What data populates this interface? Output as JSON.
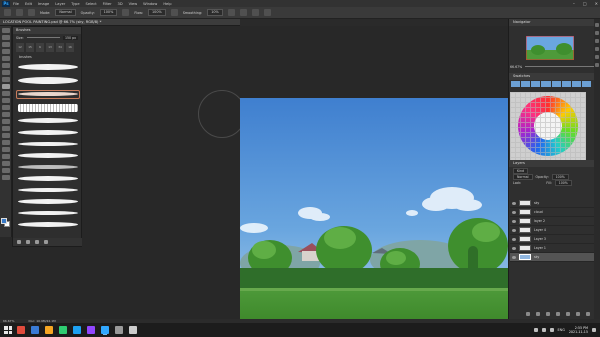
{
  "menubar": {
    "logo": "Ps",
    "items": [
      "File",
      "Edit",
      "Image",
      "Layer",
      "Type",
      "Select",
      "Filter",
      "3D",
      "View",
      "Window",
      "Help"
    ],
    "window_controls": [
      "–",
      "□",
      "✕"
    ]
  },
  "options_bar": {
    "mode_label": "Mode:",
    "mode_value": "Normal",
    "opacity_label": "Opacity:",
    "opacity_value": "100%",
    "flow_label": "Flow:",
    "flow_value": "100%",
    "smoothing_label": "Smoothing:",
    "smoothing_value": "10%"
  },
  "document": {
    "tab_title": "LOCATION POOL PAINTING.psd @ 66.7% (sky, RGB/8) *"
  },
  "brushes_panel": {
    "title": "Brushes",
    "size_label": "Size:",
    "size_value": "150 px",
    "presets": [
      "12",
      "15",
      "6",
      "13",
      "34",
      "16"
    ],
    "folder_label": "brushes"
  },
  "navigator": {
    "title": "Navigator",
    "zoom": "66.67%"
  },
  "color_panel": {
    "title": "Swatches",
    "accent": "#31a8ff"
  },
  "layers_panel": {
    "title": "Layers",
    "filter_label": "Kind",
    "blend_mode": "Normal",
    "opacity_label": "Opacity:",
    "opacity_value": "100%",
    "lock_label": "Lock:",
    "fill_label": "Fill:",
    "fill_value": "100%",
    "layers": [
      {
        "name": "sky",
        "thumb": "white",
        "active": false
      },
      {
        "name": "cloud",
        "thumb": "white",
        "active": false
      },
      {
        "name": "layer 2",
        "thumb": "white",
        "active": false
      },
      {
        "name": "Layer 4",
        "thumb": "white",
        "active": false
      },
      {
        "name": "Layer 3",
        "thumb": "white",
        "active": false
      },
      {
        "name": "Layer 1",
        "thumb": "white",
        "active": false
      },
      {
        "name": "sky",
        "thumb": "sky",
        "active": true
      }
    ]
  },
  "status_bar": {
    "zoom": "66.67%",
    "doc_size": "Doc: 10.9M/22.1M"
  },
  "taskbar": {
    "lang": "ENG",
    "time": "2:55 PM",
    "date": "2021-11-15",
    "app_colors": [
      "#e04b3c",
      "#3a7bd5",
      "#f5a623",
      "#2ecc71",
      "#1da1f2",
      "#9146ff",
      "#31a8ff",
      "#999999",
      "#cccccc"
    ]
  }
}
